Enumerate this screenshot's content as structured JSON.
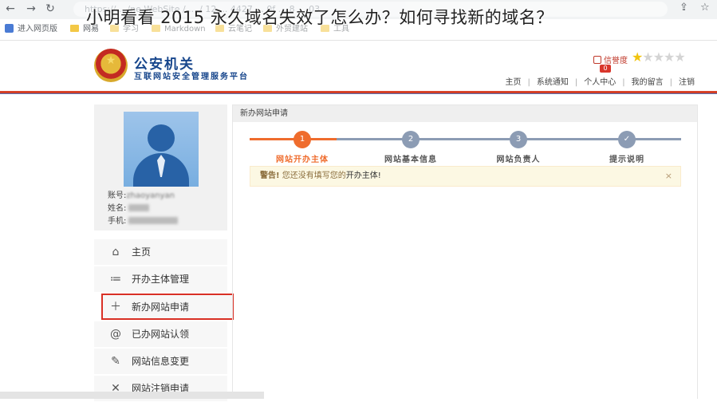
{
  "browser": {
    "back_icon": "arrow-left-icon",
    "forward_icon": "arrow-right-icon",
    "reload_icon": "reload-icon",
    "url": "https://... /ne WebSite / ... / 12 ... 4427 ... 0f ... 8 ... 03"
  },
  "watermark_text": "小明看看 2015 永久域名失效了怎么办？如何寻找新的域名？",
  "bookmarks": [
    {
      "label": "进入网页版",
      "kind": "app"
    },
    {
      "label": "网易",
      "kind": "folder"
    },
    {
      "label": "学习",
      "kind": "folder"
    },
    {
      "label": "Markdown",
      "kind": "folder"
    },
    {
      "label": "云笔记",
      "kind": "folder"
    },
    {
      "label": "外贸建站",
      "kind": "folder"
    },
    {
      "label": "工具",
      "kind": "folder"
    }
  ],
  "site": {
    "title": "公安机关",
    "subtitle": "互联网站安全管理服务平台",
    "credit_label": "信誉度",
    "credit_badge": "0",
    "stars_on": 1,
    "stars_total": 5,
    "nav_links": [
      "主页",
      "系统通知",
      "个人中心",
      "我的留言",
      "注销"
    ]
  },
  "profile": {
    "account_label": "账号:",
    "account_value": "zhaoyanyan",
    "name_label": "姓名:",
    "phone_label": "手机:"
  },
  "menu": [
    {
      "label": "主页",
      "icon": "home-icon"
    },
    {
      "label": "开办主体管理",
      "icon": "list-icon"
    },
    {
      "label": "新办网站申请",
      "icon": "plus-icon"
    },
    {
      "label": "已办网站认领",
      "icon": "at-icon"
    },
    {
      "label": "网站信息变更",
      "icon": "edit-icon"
    },
    {
      "label": "网站注销申请",
      "icon": "close-icon"
    }
  ],
  "main": {
    "panel_title": "新办网站申请",
    "steps": [
      {
        "num": "1",
        "label": "网站开办主体",
        "active": true
      },
      {
        "num": "2",
        "label": "网站基本信息",
        "active": false
      },
      {
        "num": "3",
        "label": "网站负责人",
        "active": false
      },
      {
        "num": "✓",
        "label": "提示说明",
        "active": false
      }
    ],
    "alert_prefix": "警告!",
    "alert_text": "您还没有填写您的",
    "alert_highlight": "开办主体!",
    "alert_close": "×"
  },
  "colors": {
    "accent_orange": "#ef6c2d",
    "step_inactive": "#8c9cb4",
    "brand_blue": "#17468c",
    "header_rule": "#d9432a",
    "highlight_red": "#d93025"
  }
}
